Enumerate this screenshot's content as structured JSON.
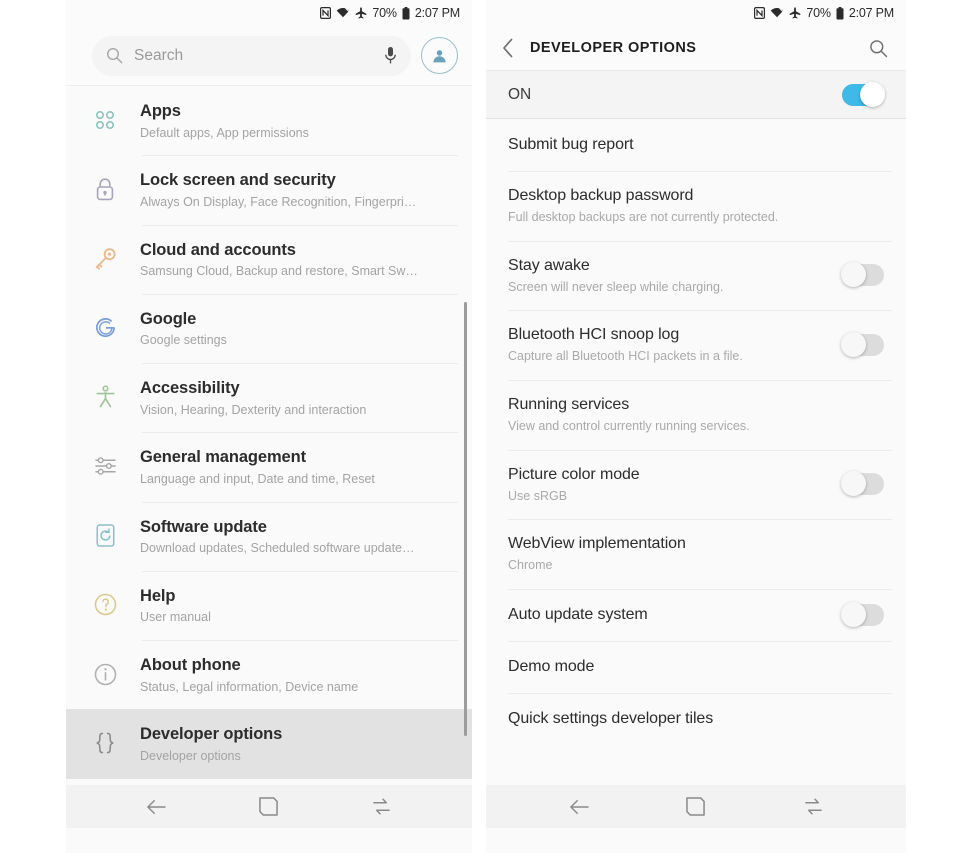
{
  "status_bar": {
    "icons": [
      "nfc-icon",
      "wifi-icon",
      "airplane-mode-icon",
      "battery-icon"
    ],
    "battery_percent": "70%",
    "time": "2:07 PM"
  },
  "left_phone": {
    "search": {
      "placeholder": "Search",
      "value": "",
      "mic_icon": "microphone-icon",
      "search_icon": "search-icon",
      "avatar_icon": "account-avatar-icon"
    },
    "items": [
      {
        "title": "Apps",
        "subtitle": "Default apps, App permissions",
        "icon": "apps-grid-icon",
        "color": "#8fc2bd",
        "selected": false
      },
      {
        "title": "Lock screen and security",
        "subtitle": "Always On Display, Face Recognition, Fingerpri…",
        "icon": "padlock-icon",
        "color": "#a9a4bd",
        "selected": false
      },
      {
        "title": "Cloud and accounts",
        "subtitle": "Samsung Cloud, Backup and restore, Smart Sw…",
        "icon": "key-icon",
        "color": "#e9b88c",
        "selected": false
      },
      {
        "title": "Google",
        "subtitle": "Google settings",
        "icon": "google-g-icon",
        "color": "#7b9fd4",
        "selected": false
      },
      {
        "title": "Accessibility",
        "subtitle": "Vision, Hearing, Dexterity and interaction",
        "icon": "accessibility-person-icon",
        "color": "#9ec49a",
        "selected": false
      },
      {
        "title": "General management",
        "subtitle": "Language and input, Date and time, Reset",
        "icon": "sliders-icon",
        "color": "#a6a6a6",
        "selected": false
      },
      {
        "title": "Software update",
        "subtitle": "Download updates, Scheduled software update…",
        "icon": "software-update-icon",
        "color": "#8fbfc6",
        "selected": false
      },
      {
        "title": "Help",
        "subtitle": "User manual",
        "icon": "help-question-icon",
        "color": "#d8c98f",
        "selected": false
      },
      {
        "title": "About phone",
        "subtitle": "Status, Legal information, Device name",
        "icon": "info-circle-icon",
        "color": "#b0b0b0",
        "selected": false
      },
      {
        "title": "Developer options",
        "subtitle": "Developer options",
        "icon": "curly-braces-icon",
        "color": "#8c8c8c",
        "selected": true
      }
    ]
  },
  "right_phone": {
    "header": {
      "back_icon": "back-chevron-icon",
      "title": "DEVELOPER OPTIONS",
      "search_icon": "search-icon"
    },
    "master_toggle": {
      "label": "ON",
      "state": "on"
    },
    "options": [
      {
        "title": "Submit bug report",
        "subtitle": "",
        "toggle": "none"
      },
      {
        "title": "Desktop backup password",
        "subtitle": "Full desktop backups are not currently protected.",
        "toggle": "none"
      },
      {
        "title": "Stay awake",
        "subtitle": "Screen will never sleep while charging.",
        "toggle": "off"
      },
      {
        "title": "Bluetooth HCI snoop log",
        "subtitle": "Capture all Bluetooth HCI packets in a file.",
        "toggle": "off"
      },
      {
        "title": "Running services",
        "subtitle": "View and control currently running services.",
        "toggle": "none"
      },
      {
        "title": "Picture color mode",
        "subtitle": "Use sRGB",
        "toggle": "off"
      },
      {
        "title": "WebView implementation",
        "subtitle": "Chrome",
        "toggle": "none"
      },
      {
        "title": "Auto update system",
        "subtitle": "",
        "toggle": "off"
      },
      {
        "title": "Demo mode",
        "subtitle": "",
        "toggle": "none"
      },
      {
        "title": "Quick settings developer tiles",
        "subtitle": "",
        "toggle": "none"
      }
    ]
  },
  "nav_bar": {
    "back_icon": "back-arrow-icon",
    "home_icon": "home-square-icon",
    "recents_icon": "recent-apps-icon"
  },
  "colors": {
    "accent_blue": "#3fb9e8",
    "panel_bg": "#fafafa",
    "selected_row": "#e2e2e2",
    "nav_bg": "#f2f2f2"
  }
}
